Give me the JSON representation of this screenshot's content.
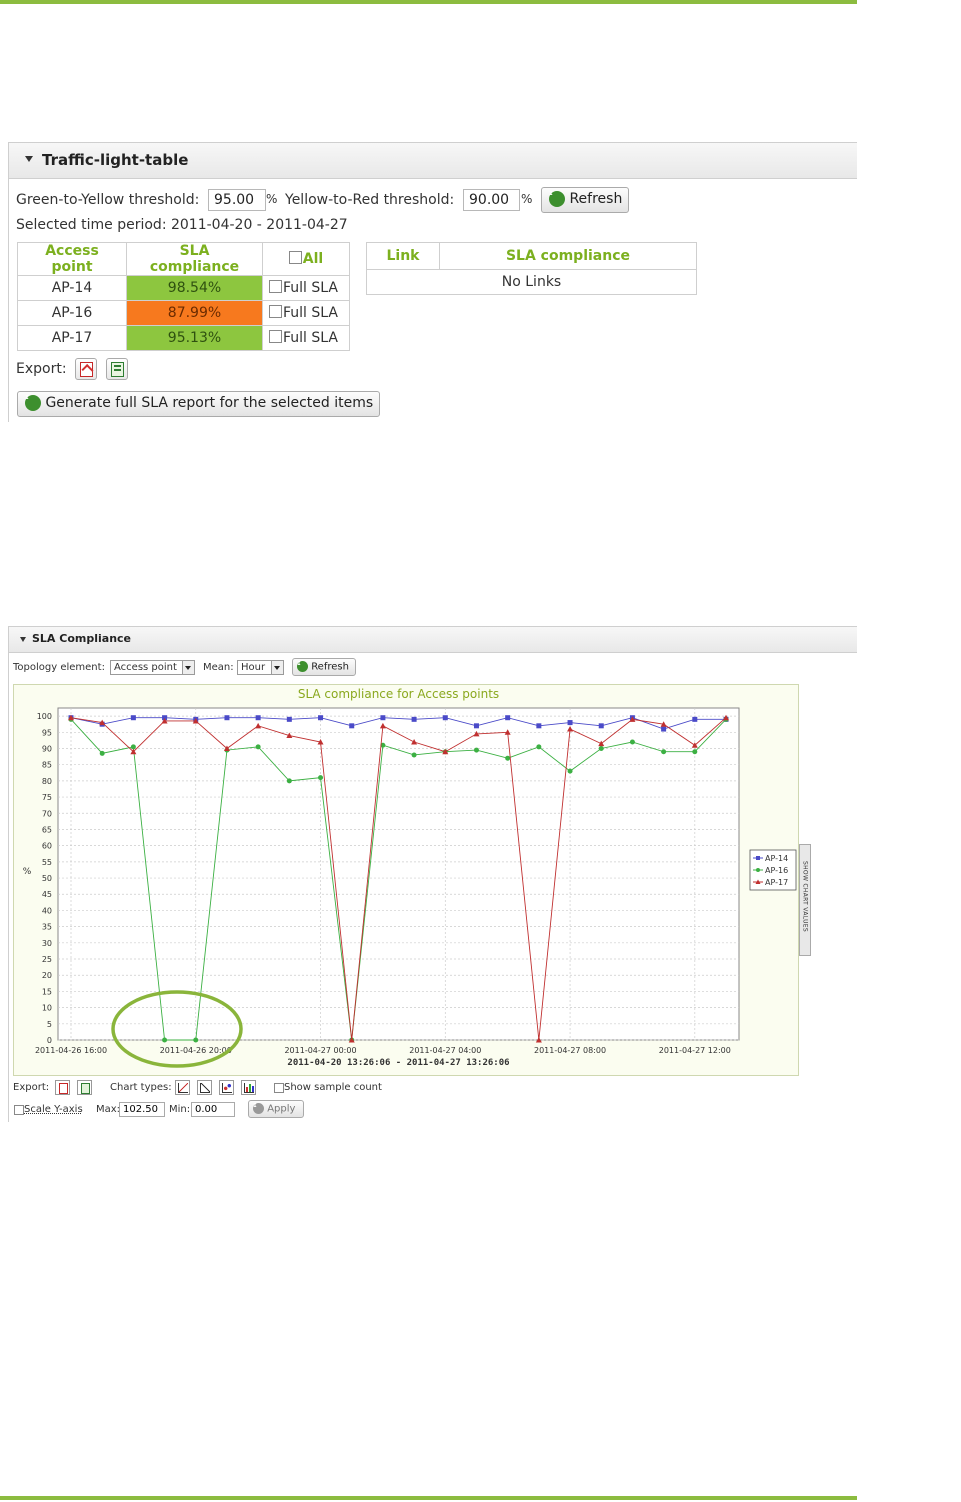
{
  "traffic_panel": {
    "title": "Traffic-light-table",
    "green_yellow_label": "Green-to-Yellow threshold:",
    "green_yellow_value": "95.00",
    "yellow_red_label": "Yellow-to-Red threshold:",
    "yellow_red_value": "90.00",
    "percent": "%",
    "refresh_label": "Refresh",
    "period_text": "Selected time period: 2011-04-20 - 2011-04-27",
    "ap_table": {
      "headers": [
        "Access point",
        "SLA compliance",
        "All"
      ],
      "rows": [
        {
          "ap": "AP-14",
          "sla": "98.54%",
          "status": "green",
          "full": "Full SLA"
        },
        {
          "ap": "AP-16",
          "sla": "87.99%",
          "status": "orange",
          "full": "Full SLA"
        },
        {
          "ap": "AP-17",
          "sla": "95.13%",
          "status": "green",
          "full": "Full SLA"
        }
      ]
    },
    "link_table": {
      "headers": [
        "Link",
        "SLA compliance"
      ],
      "empty": "No Links"
    },
    "export_label": "Export:",
    "generate_label": "Generate full SLA report for the selected items",
    "colors": {
      "green": "#8dc63f",
      "orange": "#f7791e",
      "header": "#7cb01f"
    }
  },
  "sla_panel": {
    "title": "SLA Compliance",
    "topology_label": "Topology element:",
    "topology_value": "Access point",
    "mean_label": "Mean:",
    "mean_value": "Hour",
    "refresh_label": "Refresh",
    "side_tab": "SHOW CHART VALUES",
    "export_label": "Export:",
    "chart_types_label": "Chart types:",
    "show_sample_label": "Show sample count",
    "scale_label": "Scale Y-axis",
    "max_label": "Max:",
    "max_value": "102.50",
    "min_label": "Min:",
    "min_value": "0.00",
    "apply_label": "Apply"
  },
  "chart_data": {
    "type": "line",
    "title": "SLA compliance for Access points",
    "ylabel": "%",
    "xlabel": "2011-04-20 13:26:06 - 2011-04-27 13:26:06",
    "ylim": [
      0,
      102.5
    ],
    "yticks": [
      0,
      5,
      10,
      15,
      20,
      25,
      30,
      35,
      40,
      45,
      50,
      55,
      60,
      65,
      70,
      75,
      80,
      85,
      90,
      95,
      100
    ],
    "xticks": [
      "2011-04-26 16:00",
      "2011-04-26 20:00",
      "2011-04-27 00:00",
      "2011-04-27 04:00",
      "2011-04-27 08:00",
      "2011-04-27 12:00"
    ],
    "x": [
      "2011-04-26 16:00",
      "2011-04-26 17:00",
      "2011-04-26 18:00",
      "2011-04-26 19:00",
      "2011-04-26 20:00",
      "2011-04-26 21:00",
      "2011-04-26 22:00",
      "2011-04-26 23:00",
      "2011-04-27 00:00",
      "2011-04-27 01:00",
      "2011-04-27 02:00",
      "2011-04-27 03:00",
      "2011-04-27 04:00",
      "2011-04-27 05:00",
      "2011-04-27 06:00",
      "2011-04-27 07:00",
      "2011-04-27 08:00",
      "2011-04-27 09:00",
      "2011-04-27 10:00",
      "2011-04-27 11:00",
      "2011-04-27 12:00",
      "2011-04-27 13:00"
    ],
    "series": [
      {
        "name": "AP-14",
        "color": "#4a4ac8",
        "marker": "square",
        "values": [
          99.5,
          97.5,
          99.5,
          99.5,
          99.0,
          99.5,
          99.5,
          99.0,
          99.5,
          97.0,
          99.5,
          99.0,
          99.5,
          97.0,
          99.5,
          97.0,
          98.0,
          97.0,
          99.5,
          96.0,
          99.0,
          99.0
        ]
      },
      {
        "name": "AP-16",
        "color": "#3cb043",
        "marker": "circle",
        "values": [
          99.0,
          88.5,
          90.5,
          0,
          0,
          89.5,
          90.5,
          80.0,
          81.0,
          0,
          91.0,
          88.0,
          89.0,
          89.5,
          87.0,
          90.5,
          83.0,
          90.0,
          92.0,
          89.0,
          89.0,
          99.0
        ]
      },
      {
        "name": "AP-17",
        "color": "#c03030",
        "marker": "triangle",
        "values": [
          99.5,
          98.0,
          89.0,
          98.5,
          98.5,
          90.0,
          97.0,
          94.0,
          92.0,
          0,
          97.0,
          92.0,
          89.0,
          94.5,
          95.0,
          0,
          96.0,
          91.5,
          99.0,
          97.5,
          91.0,
          99.5
        ]
      }
    ],
    "legend": "right",
    "grid": true,
    "annotation": "green-ellipse-highlight"
  }
}
